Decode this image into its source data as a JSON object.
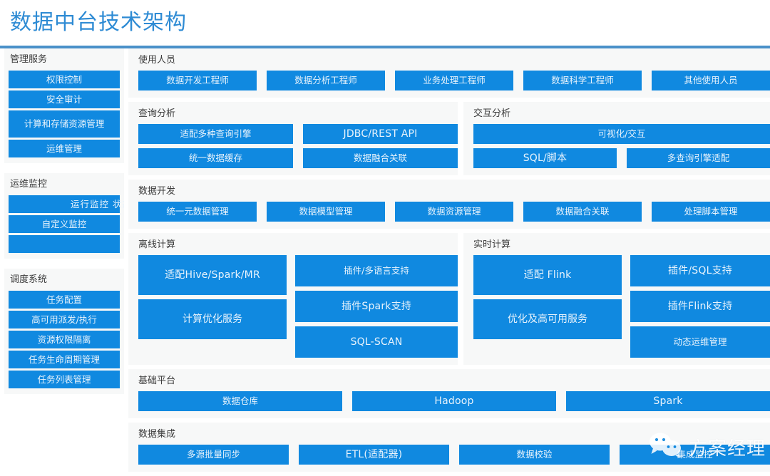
{
  "header": {
    "title": "数据中台技术架构",
    "title_color": "#2e8bd4",
    "rule_color": "#4a90c9"
  },
  "theme": {
    "bar_color": "#1089e0",
    "panel_bg": "#f7f8f8",
    "bar_text_color": "#e8f3fc",
    "page_bg": "#ffffff"
  },
  "sidebar": {
    "sections": [
      {
        "title": "管理服务",
        "items": [
          {
            "label": "权限控制"
          },
          {
            "label": "安全审计"
          },
          {
            "label": "计算和存储资源管理"
          },
          {
            "label": "运维管理"
          }
        ]
      },
      {
        "title": "运维监控",
        "items": [
          {
            "label": "运行监控 状态监测"
          },
          {
            "label": "自定义监控"
          },
          {
            "label": ""
          }
        ]
      },
      {
        "title": "调度系统",
        "items": [
          {
            "label": "任务配置"
          },
          {
            "label": "高可用派发/执行"
          },
          {
            "label": "资源权限隔离"
          },
          {
            "label": "任务生命周期管理"
          },
          {
            "label": "任务列表管理"
          }
        ]
      }
    ]
  },
  "main": {
    "users": {
      "title": "使用人员",
      "items": [
        "数据开发工程师",
        "数据分析工程师",
        "业务处理工程师",
        "数据科学工程师",
        "其他使用人员"
      ]
    },
    "query_analysis": {
      "title": "查询分析",
      "row1": [
        "适配多种查询引擎",
        "JDBC/REST API"
      ],
      "row2": [
        "统一数据缓存",
        "数据融合关联"
      ]
    },
    "interactive_analysis": {
      "title": "交互分析",
      "row1": [
        "可视化/交互"
      ],
      "row2": [
        "SQL/脚本",
        "多查询引擎适配"
      ]
    },
    "data_development": {
      "title": "数据开发",
      "items": [
        "统一元数据管理",
        "数据模型管理",
        "数据资源管理",
        "数据融合关联",
        "处理脚本管理"
      ]
    },
    "offline_compute": {
      "title": "离线计算",
      "left": [
        "适配Hive/Spark/MR",
        "计算优化服务"
      ],
      "right": [
        "插件/多语言支持",
        "插件Spark支持",
        "SQL-SCAN"
      ]
    },
    "realtime_compute": {
      "title": "实时计算",
      "left": [
        "适配 Flink",
        "优化及高可用服务"
      ],
      "right": [
        "插件/SQL支持",
        "插件Flink支持",
        "动态运维管理"
      ]
    },
    "base_platform": {
      "title": "基础平台",
      "items": [
        "数据仓库",
        "Hadoop",
        "Spark"
      ]
    },
    "data_integration": {
      "title": "数据集成",
      "items": [
        "多源批量同步",
        "ETL(适配器)",
        "数据校验",
        "集成监控"
      ]
    }
  },
  "watermark": {
    "text": "方案经理",
    "icon": "wechat-icon"
  }
}
